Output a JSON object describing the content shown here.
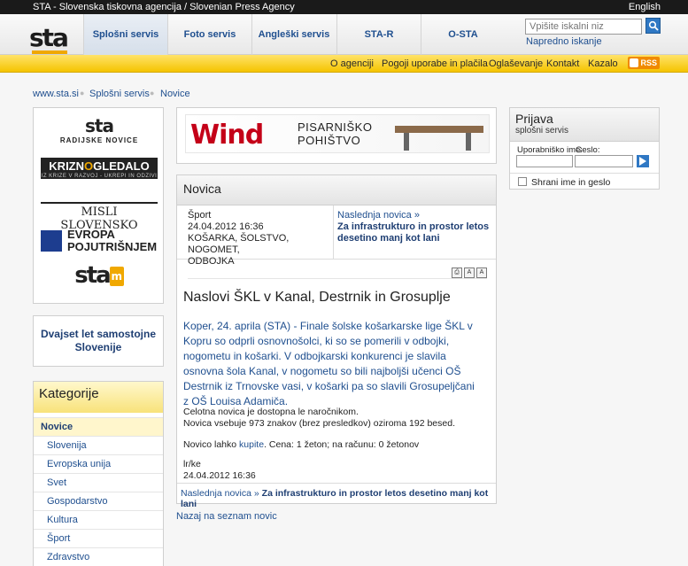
{
  "topbar": {
    "title": "STA - Slovenska tiskovna agencija / Slovenian Press Agency",
    "lang": "English"
  },
  "header": {
    "logo": "sta",
    "nav": [
      "Splošni servis",
      "Foto servis",
      "Angleški servis",
      "STA-R",
      "O-STA"
    ],
    "search_placeholder": "Vpišite iskalni niz",
    "advanced_search": "Napredno iskanje"
  },
  "yellowbar": {
    "links": [
      "O agenciji",
      "Pogoji uporabe in plačila",
      "Oglaševanje",
      "Kontakt",
      "Kazalo"
    ],
    "rss": "RSS"
  },
  "breadcrumb": [
    "www.sta.si",
    "Splošni servis",
    "Novice"
  ],
  "left": {
    "sta_radio_big": "sta",
    "sta_radio_small": "RADIJSKE NOVICE",
    "krizno_a": "KRIZN",
    "krizno_o": "O",
    "krizno_b": "GLEDALO",
    "krizno_sub": "IZ KRIZE V RAZVOJ - UKREPI IN ODZIVI",
    "misli": "MISLI SLOVENSKO",
    "evropa_1": "EVROPA",
    "evropa_2": "POJUTRIŠNJEM",
    "sta_m": "sta",
    "sta_m_letter": "m",
    "dvajset": "Dvajset let samostojne Slovenije",
    "kategorije_title": "Kategorije",
    "kategorije": [
      "Novice",
      "Slovenija",
      "Evropska unija",
      "Svet",
      "Gospodarstvo",
      "Kultura",
      "Šport",
      "Zdravstvo"
    ]
  },
  "ad": {
    "brand": "Wind",
    "text_1": "PISARNIŠKO",
    "text_2": "POHIŠTVO"
  },
  "novica": {
    "heading": "Novica",
    "meta_left": [
      "Šport",
      "24.04.2012 16:36",
      "KOŠARKA, ŠOLSTVO, NOGOMET,",
      "ODBOJKA"
    ],
    "next_label": "Naslednja novica »",
    "next_title": "Za infrastrukturo in prostor letos desetino manj kot lani",
    "tools": [
      "print-icon",
      "font-smaller-icon",
      "font-larger-icon"
    ],
    "title": "Naslovi ŠKL v Kanal, Destrnik in Grosuplje",
    "lead": "Koper, 24. aprila (STA) - Finale šolske košarkarske lige ŠKL v Kopru so odprli osnovnošolci, ki so se pomerili v odbojki, nogometu in košarki. V odbojkarski konkurenci je slavila osnovna šola Kanal, v nogometu so bili najboljši učenci OŠ Destrnik iz Trnovske vasi, v košarki pa so slavili Grosupeljčani z OŠ Louisa Adamiča.",
    "body_1": "Celotna novica je dostopna le naročnikom.",
    "body_2": "Novica vsebuje 973 znakov (brez presledkov) oziroma 192 besed.",
    "buy_pre": "Novico lahko ",
    "buy_link": "kupite",
    "buy_post": ". Cena: 1 žeton; na računu: 0 žetonov",
    "sig_1": "lr/ke",
    "sig_2": "24.04.2012 16:36",
    "foot_label": "Naslednja novica »",
    "foot_title": "Za infrastrukturo in prostor letos desetino manj kot lani",
    "back": "Nazaj na seznam novic"
  },
  "prijava": {
    "title": "Prijava",
    "subtitle": "splošni servis",
    "user_label": "Uporabniško ime:",
    "pass_label": "Geslo:",
    "remember": "Shrani ime in geslo"
  }
}
